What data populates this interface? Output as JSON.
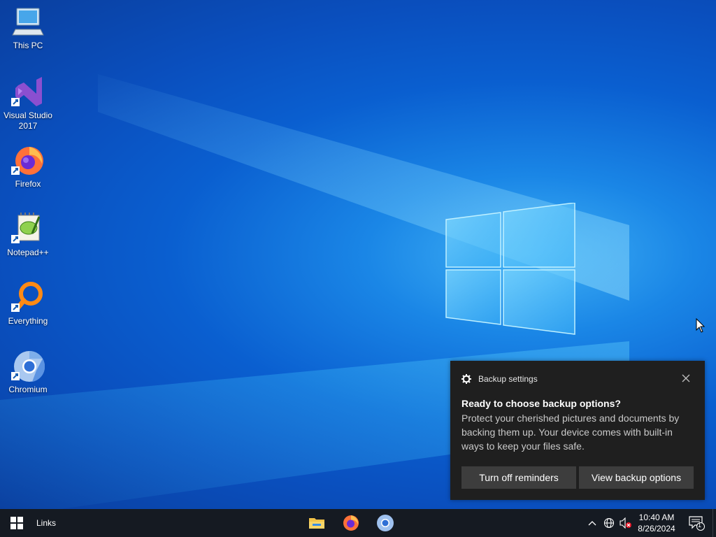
{
  "desktop": {
    "icons": [
      {
        "label_line1": "This PC",
        "label_line2": "",
        "icon": "this-pc-icon"
      },
      {
        "label_line1": "Visual Studio",
        "label_line2": "2017",
        "icon": "visual-studio-icon"
      },
      {
        "label_line1": "Firefox",
        "label_line2": "",
        "icon": "firefox-icon"
      },
      {
        "label_line1": "Notepad++",
        "label_line2": "",
        "icon": "notepad-plus-plus-icon"
      },
      {
        "label_line1": "Everything",
        "label_line2": "",
        "icon": "everything-search-icon"
      },
      {
        "label_line1": "Chromium",
        "label_line2": "",
        "icon": "chromium-icon"
      }
    ],
    "wallpaper_accent": "#0a5fd0"
  },
  "toast": {
    "app_name": "Backup settings",
    "app_icon": "gear-icon",
    "title": "Ready to choose backup options?",
    "body": "Protect your cherished pictures and documents by backing them up. Your device comes with built-in ways to keep your files safe.",
    "button_dismiss": "Turn off reminders",
    "button_action": "View backup options",
    "close_icon": "close-icon"
  },
  "taskbar": {
    "links_label": "Links",
    "apps": [
      "file-explorer-icon",
      "firefox-icon",
      "chromium-icon"
    ],
    "tray": {
      "time": "10:40 AM",
      "date": "8/26/2024",
      "notification_count": "1",
      "icons": [
        "chevron-up-icon",
        "network-globe-icon",
        "volume-muted-icon"
      ]
    }
  }
}
